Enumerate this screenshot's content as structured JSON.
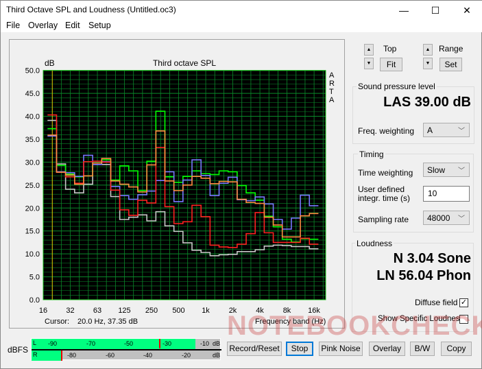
{
  "window": {
    "title": "Third Octave SPL and Loudness (Untitled.oc3)",
    "minimize": "—",
    "maximize": "☐",
    "close": "✕"
  },
  "menu": [
    "File",
    "Overlay",
    "Edit",
    "Setup"
  ],
  "chart_data": {
    "type": "line",
    "title": "Third octave SPL",
    "ylabel": "dB",
    "xlabel": "Frequency band (Hz)",
    "side_label": [
      "A",
      "R",
      "T",
      "A"
    ],
    "ylim": [
      0,
      50
    ],
    "yticks": [
      "0.0",
      "5.0",
      "10.0",
      "15.0",
      "20.0",
      "25.0",
      "30.0",
      "35.0",
      "40.0",
      "45.0",
      "50.0"
    ],
    "xticks": [
      "16",
      "32",
      "63",
      "125",
      "250",
      "500",
      "1k",
      "2k",
      "4k",
      "8k",
      "16k"
    ],
    "grid": true,
    "step": true,
    "background": "#000000",
    "grid_color": "#0a8a2a",
    "frame_color": "#18c018",
    "cursor_hz": 20,
    "bands": [
      "20",
      "25",
      "31.5",
      "40",
      "50",
      "63",
      "80",
      "100",
      "125",
      "160",
      "200",
      "250",
      "315",
      "400",
      "500",
      "630",
      "800",
      "1k",
      "1.25k",
      "1.6k",
      "2k",
      "2.5k",
      "3.15k",
      "4k",
      "5k",
      "6.3k",
      "8k",
      "10k",
      "12.5k",
      "16k"
    ],
    "series": [
      {
        "color": "#c8c8c8",
        "values": [
          39.1,
          29.6,
          24.1,
          23.3,
          25.2,
          29.5,
          29.5,
          22.5,
          17.5,
          18.0,
          18.5,
          17.2,
          19.2,
          16.1,
          14.9,
          12.4,
          10.8,
          10.3,
          9.6,
          9.8,
          9.9,
          10.5,
          10.5,
          10.9,
          11.7,
          11.9,
          11.8,
          11.6,
          11.6,
          11.1
        ]
      },
      {
        "color": "#00ff00",
        "values": [
          37.3,
          29.3,
          27.4,
          26.8,
          27.0,
          29.8,
          30.5,
          26.1,
          29.2,
          28.1,
          23.8,
          30.2,
          41.1,
          26.8,
          25.6,
          26.9,
          28.1,
          27.5,
          27.3,
          28.1,
          27.9,
          24.9,
          23.3,
          21.7,
          18.2,
          15.9,
          13.2,
          12.6,
          13.3,
          13.2
        ]
      },
      {
        "color": "#7878ff",
        "values": [
          35.7,
          27.9,
          27.7,
          26.9,
          31.5,
          29.5,
          30.1,
          24.7,
          22.7,
          21.9,
          22.9,
          23.7,
          26.0,
          27.9,
          21.4,
          26.1,
          30.5,
          27.1,
          22.7,
          25.4,
          26.7,
          21.8,
          21.6,
          22.4,
          20.9,
          17.5,
          15.4,
          17.8,
          22.8,
          20.5
        ]
      },
      {
        "color": "#ff2020",
        "values": [
          40.3,
          27.8,
          26.8,
          25.4,
          30.1,
          30.2,
          30.0,
          23.9,
          19.6,
          18.4,
          21.7,
          21.1,
          33.2,
          20.3,
          16.6,
          17.0,
          20.6,
          18.1,
          11.9,
          11.5,
          11.4,
          12.1,
          14.4,
          19.0,
          14.6,
          12.5,
          12.5,
          12.5,
          13.4,
          12.1
        ]
      },
      {
        "color": "#ff8c40",
        "values": [
          35.9,
          27.8,
          27.2,
          25.2,
          27.0,
          29.8,
          30.8,
          25.9,
          25.2,
          24.6,
          23.5,
          29.4,
          36.8,
          25.9,
          23.8,
          25.0,
          26.9,
          26.5,
          25.3,
          25.8,
          25.7,
          21.9,
          21.2,
          21.0,
          18.0,
          16.3,
          13.7,
          13.7,
          18.3,
          18.8
        ]
      }
    ]
  },
  "cursor": {
    "label": "Cursor:",
    "value": "20.0 Hz, 37.35 dB"
  },
  "controls": {
    "top_label": "Top",
    "fit": "Fit",
    "range_label": "Range",
    "set": "Set",
    "up": "▲",
    "down": "▼"
  },
  "spl": {
    "group": "Sound pressure level",
    "value": "LAS 39.00 dB",
    "freq_label": "Freq. weighting",
    "freq_value": "A"
  },
  "timing": {
    "group": "Timing",
    "tw_label": "Time weighting",
    "tw_value": "Slow",
    "it_label1": "User defined",
    "it_label2": "integr. time (s)",
    "it_value": "10",
    "sr_label": "Sampling rate",
    "sr_value": "48000"
  },
  "loudness": {
    "group": "Loudness",
    "n": "N 3.04 Sone",
    "ln": "LN 56.04 Phon",
    "diffuse": "Diffuse field",
    "diffuse_checked": true,
    "specific": "Show Specific Loudness",
    "specific_checked": false
  },
  "meter": {
    "label": "dBFS",
    "l": "L",
    "r": "R",
    "l_ticks": [
      "-90",
      "-70",
      "-50",
      "-30",
      "-10",
      "dB"
    ],
    "r_ticks": [
      "-80",
      "-60",
      "-40",
      "-20",
      "dB"
    ],
    "l_level_dbfs": -37,
    "r_level_dbfs": -84,
    "fill": "#00ff80"
  },
  "buttons": [
    "Record/Reset",
    "Stop",
    "Pink Noise",
    "Overlay",
    "B/W",
    "Copy"
  ],
  "watermark": "NOTEBOOKCHECK"
}
